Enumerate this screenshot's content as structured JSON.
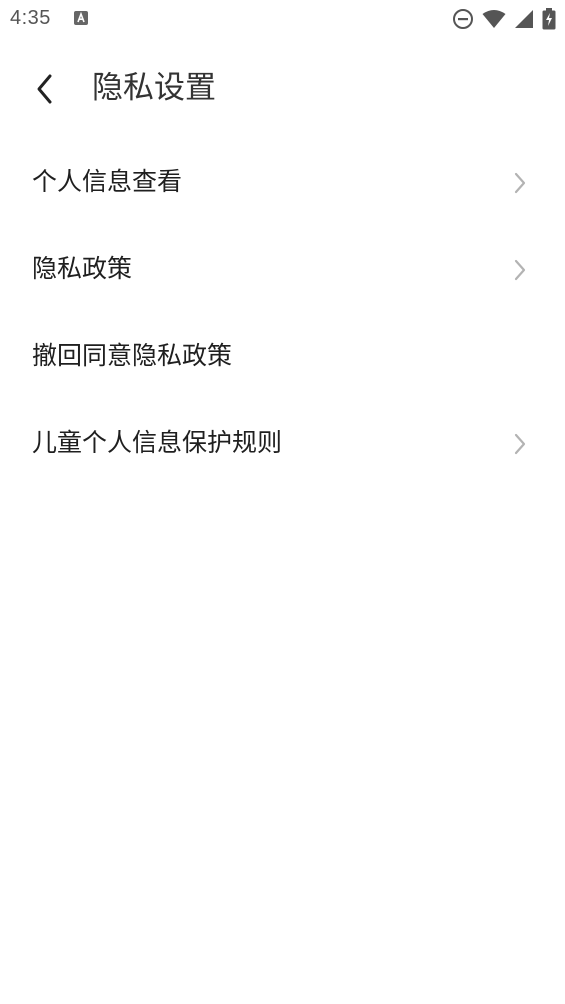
{
  "status_bar": {
    "time": "4:35",
    "notification_icon": "a-box-icon",
    "icons": [
      "do-not-disturb-icon",
      "wifi-icon",
      "signal-icon",
      "battery-charging-icon"
    ]
  },
  "header": {
    "title": "隐私设置",
    "back_icon": "chevron-left-icon"
  },
  "menu": {
    "items": [
      {
        "label": "个人信息查看",
        "has_chevron": true
      },
      {
        "label": "隐私政策",
        "has_chevron": true
      },
      {
        "label": "撤回同意隐私政策",
        "has_chevron": false
      },
      {
        "label": "儿童个人信息保护规则",
        "has_chevron": true
      }
    ]
  },
  "colors": {
    "background": "#ffffff",
    "text": "#1f1f1f",
    "chevron": "#b3b3b3",
    "status_icons": "#555555"
  }
}
